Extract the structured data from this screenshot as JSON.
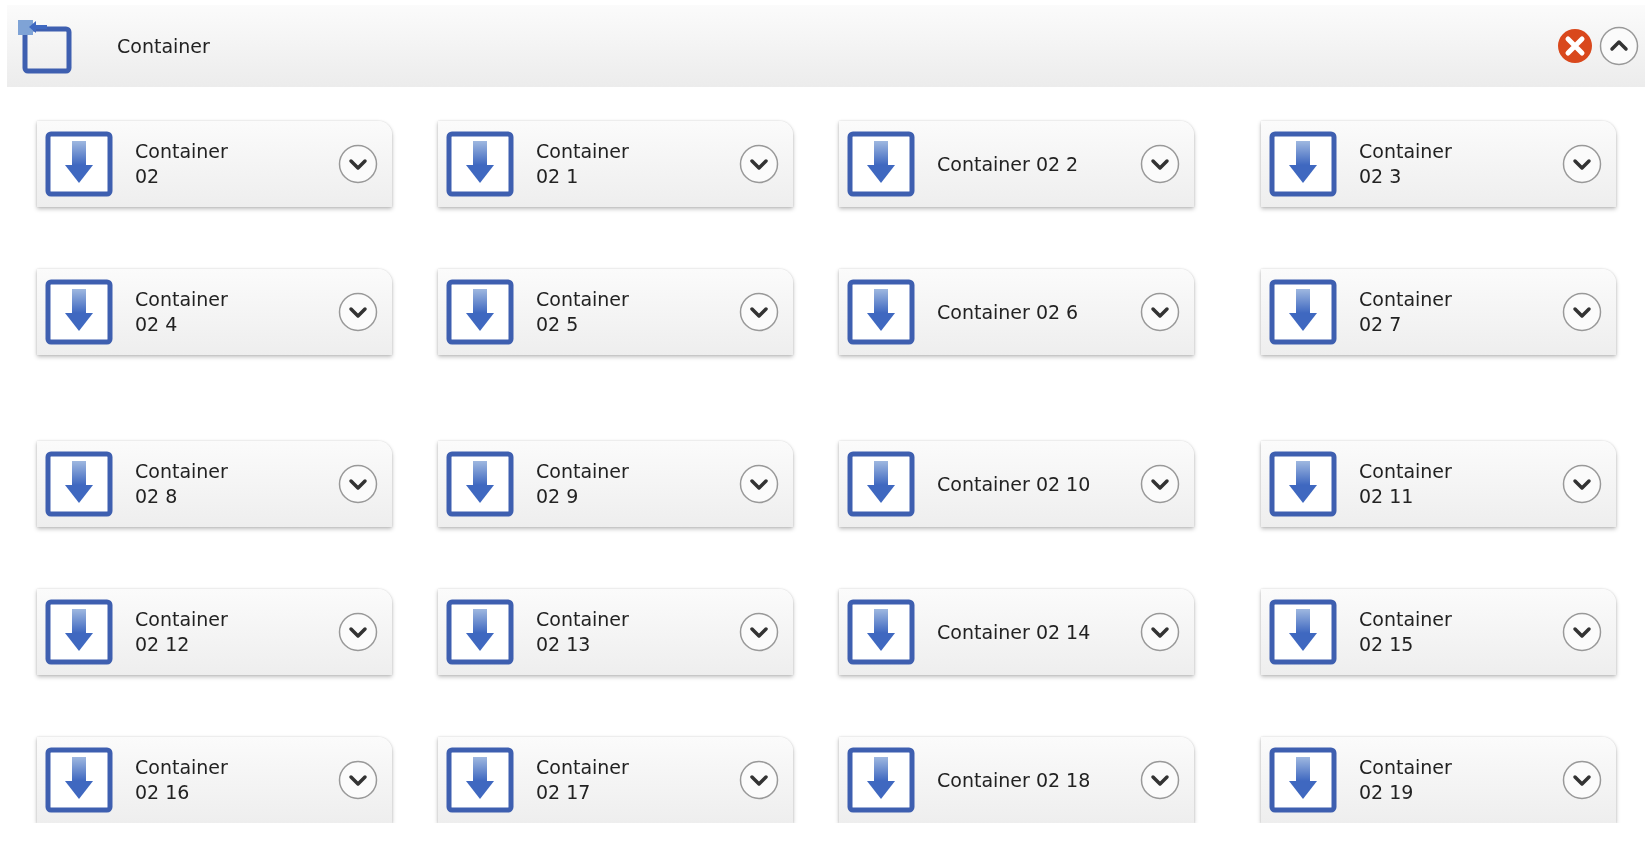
{
  "header": {
    "title": "Container"
  },
  "cards": [
    {
      "label": "Container 02"
    },
    {
      "label": "Container 02 1"
    },
    {
      "label": "Container 02 2"
    },
    {
      "label": "Container 02 3"
    },
    {
      "label": "Container 02 4"
    },
    {
      "label": "Container 02 5"
    },
    {
      "label": "Container 02 6"
    },
    {
      "label": "Container 02 7"
    },
    {
      "label": "Container 02 8"
    },
    {
      "label": "Container 02 9"
    },
    {
      "label": "Container 02 10"
    },
    {
      "label": "Container 02 11"
    },
    {
      "label": "Container 02 12"
    },
    {
      "label": "Container 02 13"
    },
    {
      "label": "Container 02 14"
    },
    {
      "label": "Container 02 15"
    },
    {
      "label": "Container 02 16"
    },
    {
      "label": "Container 02 17"
    },
    {
      "label": "Container 02 18"
    },
    {
      "label": "Container 02 19"
    }
  ]
}
